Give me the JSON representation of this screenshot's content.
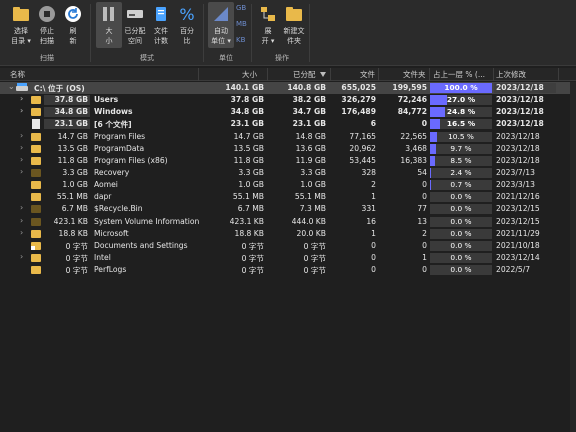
{
  "ribbon": {
    "buttons": [
      {
        "name": "select-dir-button",
        "label": "选择\n目录 ▾"
      },
      {
        "name": "stop-scan-button",
        "label": "停止\n扫描"
      },
      {
        "name": "refresh-button",
        "label": "刷\n新"
      },
      {
        "name": "size-mode-button",
        "label": "大\n小"
      },
      {
        "name": "allocated-mode-button",
        "label": "已分配\n空间"
      },
      {
        "name": "file-count-button",
        "label": "文件\n计数"
      },
      {
        "name": "percent-button",
        "label": "百分\n比"
      },
      {
        "name": "auto-unit-button",
        "label": "自动\n单位 ▾"
      },
      {
        "name": "expand-button",
        "label": "展\n开 ▾"
      },
      {
        "name": "new-folder-button",
        "label": "新建文\n件夹"
      }
    ],
    "units": [
      "GB",
      "MB",
      "KB"
    ],
    "groups": {
      "scan": "扫描",
      "mode": "模式",
      "unit": "单位",
      "ops": "操作"
    }
  },
  "columns": [
    "名称",
    "大小",
    "已分配",
    "文件",
    "文件夹",
    "占上一层 % (...",
    "上次修改"
  ],
  "rows": [
    {
      "name": "C:\\  位于 (OS)",
      "size_blk": "140.1 GB",
      "size": "140.1 GB",
      "alloc": "140.8 GB",
      "files": "655,025",
      "folders": "199,595",
      "pct": "100.0 %",
      "frac": 1.0,
      "date": "2023/12/18",
      "kind": "drive",
      "sel": true,
      "bold": true,
      "level": 0
    },
    {
      "name": "Users",
      "size_blk": "37.8 GB",
      "size": "37.8 GB",
      "alloc": "38.2 GB",
      "files": "326,279",
      "folders": "72,246",
      "pct": "27.0 %",
      "frac": 0.27,
      "date": "2023/12/18",
      "kind": "folder",
      "bold": true,
      "level": 1
    },
    {
      "name": "Windows",
      "size_blk": "34.8 GB",
      "size": "34.8 GB",
      "alloc": "34.7 GB",
      "files": "176,489",
      "folders": "84,772",
      "pct": "24.8 %",
      "frac": 0.248,
      "date": "2023/12/18",
      "kind": "folder",
      "bold": true,
      "level": 1
    },
    {
      "name": "[6 个文件]",
      "size_blk": "23.1 GB",
      "size": "23.1 GB",
      "alloc": "23.1 GB",
      "files": "6",
      "folders": "0",
      "pct": "16.5 %",
      "frac": 0.165,
      "date": "2023/12/18",
      "kind": "file",
      "bold": true,
      "level": 1
    },
    {
      "name": "Program Files",
      "size_blk": "14.7 GB",
      "size": "14.7 GB",
      "alloc": "14.8 GB",
      "files": "77,165",
      "folders": "22,565",
      "pct": "10.5 %",
      "frac": 0.105,
      "date": "2023/12/18",
      "kind": "folder",
      "level": 1
    },
    {
      "name": "ProgramData",
      "size_blk": "13.5 GB",
      "size": "13.5 GB",
      "alloc": "13.6 GB",
      "files": "20,962",
      "folders": "3,468",
      "pct": "9.7 %",
      "frac": 0.097,
      "date": "2023/12/18",
      "kind": "folder",
      "level": 1
    },
    {
      "name": "Program Files (x86)",
      "size_blk": "11.8 GB",
      "size": "11.8 GB",
      "alloc": "11.9 GB",
      "files": "53,445",
      "folders": "16,383",
      "pct": "8.5 %",
      "frac": 0.085,
      "date": "2023/12/18",
      "kind": "folder",
      "level": 1
    },
    {
      "name": "Recovery",
      "size_blk": "3.3 GB",
      "size": "3.3 GB",
      "alloc": "3.3 GB",
      "files": "328",
      "folders": "54",
      "pct": "2.4 %",
      "frac": 0.024,
      "date": "2023/7/13",
      "kind": "folder-dark",
      "level": 1
    },
    {
      "name": "Aomei",
      "size_blk": "1.0 GB",
      "size": "1.0 GB",
      "alloc": "1.0 GB",
      "files": "2",
      "folders": "0",
      "pct": "0.7 %",
      "frac": 0.007,
      "date": "2023/3/13",
      "kind": "folder",
      "level": 1
    },
    {
      "name": "dapr",
      "size_blk": "55.1 MB",
      "size": "55.1 MB",
      "alloc": "55.1 MB",
      "files": "1",
      "folders": "0",
      "pct": "0.0 %",
      "frac": 0,
      "date": "2021/12/16",
      "kind": "folder",
      "level": 1
    },
    {
      "name": "$Recycle.Bin",
      "size_blk": "6.7 MB",
      "size": "6.7 MB",
      "alloc": "7.3 MB",
      "files": "331",
      "folders": "77",
      "pct": "0.0 %",
      "frac": 0,
      "date": "2023/12/15",
      "kind": "folder-dark",
      "level": 1
    },
    {
      "name": "System Volume Information",
      "size_blk": "423.1 KB",
      "size": "423.1 KB",
      "alloc": "444.0 KB",
      "files": "16",
      "folders": "13",
      "pct": "0.0 %",
      "frac": 0,
      "date": "2023/12/15",
      "kind": "folder-dark",
      "level": 1
    },
    {
      "name": "Microsoft",
      "size_blk": "18.8 KB",
      "size": "18.8 KB",
      "alloc": "20.0 KB",
      "files": "1",
      "folders": "2",
      "pct": "0.0 %",
      "frac": 0,
      "date": "2021/11/29",
      "kind": "folder",
      "level": 1
    },
    {
      "name": "Documents and Settings",
      "size_blk": "0 字节",
      "size": "0 字节",
      "alloc": "0 字节",
      "files": "0",
      "folders": "0",
      "pct": "0.0 %",
      "frac": 0,
      "date": "2021/10/18",
      "kind": "folder-link",
      "level": 1
    },
    {
      "name": "Intel",
      "size_blk": "0 字节",
      "size": "0 字节",
      "alloc": "0 字节",
      "files": "0",
      "folders": "1",
      "pct": "0.0 %",
      "frac": 0,
      "date": "2023/12/14",
      "kind": "folder",
      "level": 1
    },
    {
      "name": "PerfLogs",
      "size_blk": "0 字节",
      "size": "0 字节",
      "alloc": "0 字节",
      "files": "0",
      "folders": "0",
      "pct": "0.0 %",
      "frac": 0,
      "date": "2022/5/7",
      "kind": "folder",
      "level": 1
    }
  ],
  "colors": {
    "accent": "#6a6aff",
    "folder": "#e9b94a",
    "selected": "#454545"
  }
}
